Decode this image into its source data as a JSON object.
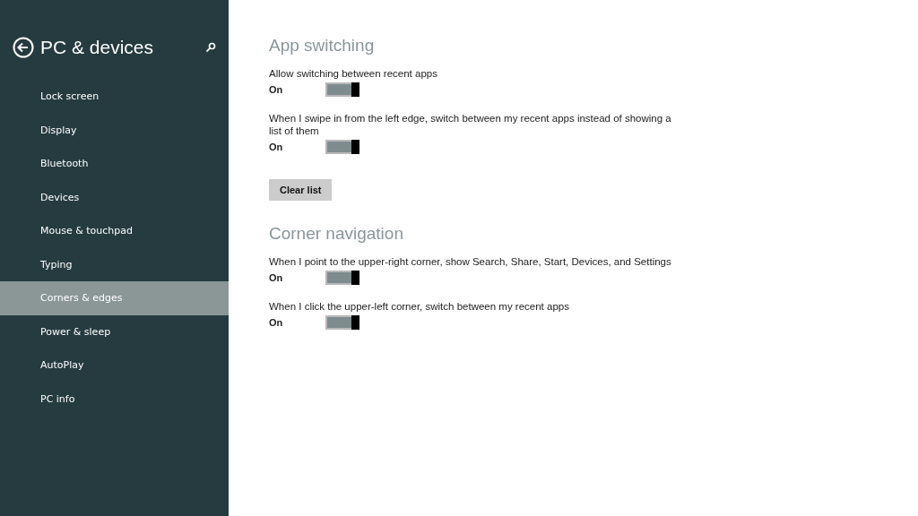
{
  "sidebar": {
    "title": "PC & devices",
    "items": [
      {
        "label": "Lock screen",
        "selected": false
      },
      {
        "label": "Display",
        "selected": false
      },
      {
        "label": "Bluetooth",
        "selected": false
      },
      {
        "label": "Devices",
        "selected": false
      },
      {
        "label": "Mouse & touchpad",
        "selected": false
      },
      {
        "label": "Typing",
        "selected": false
      },
      {
        "label": "Corners & edges",
        "selected": true
      },
      {
        "label": "Power & sleep",
        "selected": false
      },
      {
        "label": "AutoPlay",
        "selected": false
      },
      {
        "label": "PC info",
        "selected": false
      }
    ]
  },
  "sections": [
    {
      "heading": "App switching",
      "items": [
        {
          "kind": "toggle",
          "label": "Allow switching between recent apps",
          "state_text": "On",
          "on": true
        },
        {
          "kind": "toggle",
          "label": "When I swipe in from the left edge, switch between my recent apps instead of showing a list of them",
          "state_text": "On",
          "on": true
        },
        {
          "kind": "button",
          "label": "Clear list"
        }
      ]
    },
    {
      "heading": "Corner navigation",
      "items": [
        {
          "kind": "toggle",
          "label": "When I point to the upper-right corner, show Search, Share, Start, Devices, and Settings",
          "state_text": "On",
          "on": true
        },
        {
          "kind": "toggle",
          "label": "When I click the upper-left corner, switch between my recent apps",
          "state_text": "On",
          "on": true
        }
      ]
    }
  ]
}
